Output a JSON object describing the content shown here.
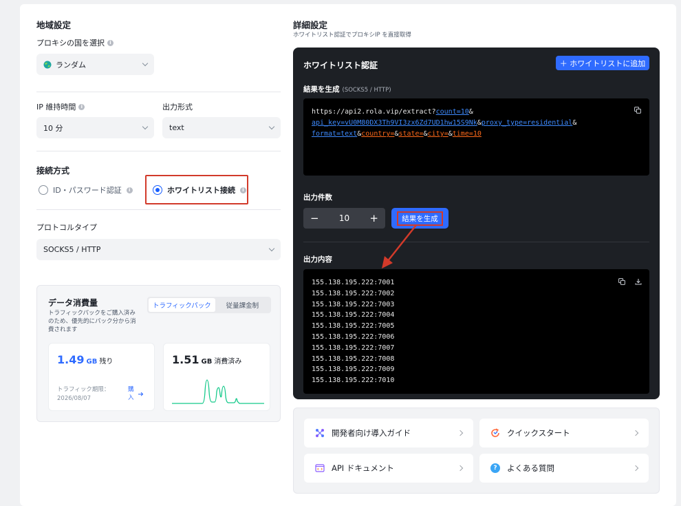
{
  "region": {
    "title": "地域設定",
    "country_label": "プロキシの国を選択",
    "country_value": "ランダム",
    "ip_duration_label": "IP 維持時間",
    "ip_duration_value": "10 分",
    "output_format_label": "出力形式",
    "output_format_value": "text"
  },
  "connection": {
    "title": "接続方式",
    "option_password": "ID・パスワード認証",
    "option_whitelist": "ホワイトリスト接続",
    "selected": "whitelist"
  },
  "protocol": {
    "label": "プロトコルタイプ",
    "value": "SOCKS5 / HTTP"
  },
  "data_usage": {
    "title": "データ消費量",
    "description": "トラフィックパックをご購入済みのため、優先的にパック分から消費されます",
    "tab_traffic": "トラフィックパック",
    "tab_metered": "従量課金制",
    "remaining_value": "1.49",
    "remaining_unit": "GB",
    "remaining_suffix": "残り",
    "expiry_label": "トラフィック期限：",
    "expiry_date": "2026/08/07",
    "buy_label": "購入",
    "consumed_value": "1.51",
    "consumed_unit": "GB",
    "consumed_suffix": "消費済み"
  },
  "advanced": {
    "title": "詳細設定",
    "subtitle": "ホワイトリスト認証でプロキシIP を直接取得"
  },
  "whitelist": {
    "title": "ホワイトリスト認証",
    "add_button": "＋ ホワイトリストに追加",
    "result_label": "結果を生成",
    "result_protocol": "(SOCKS5 / HTTP)",
    "url_base": "https://api2.rola.vip/extract?",
    "url_count": "count=10",
    "url_apikey": "api_key=vU0M80DX3Th9VI3zx6Zd7UD1hw15S9Nk",
    "url_proxy_type": "proxy_type=residential",
    "url_format": "format=text",
    "url_country": "country=",
    "url_state": "state=",
    "url_city": "city=",
    "url_time": "time=10",
    "amp": "&",
    "count_label": "出力件数",
    "count_value": "10",
    "generate_button": "結果を生成",
    "output_label": "出力内容",
    "output_lines": [
      "155.138.195.222:7001",
      "155.138.195.222:7002",
      "155.138.195.222:7003",
      "155.138.195.222:7004",
      "155.138.195.222:7005",
      "155.138.195.222:7006",
      "155.138.195.222:7007",
      "155.138.195.222:7008",
      "155.138.195.222:7009",
      "155.138.195.222:7010"
    ]
  },
  "guides": {
    "developer": "開発者向け導入ガイド",
    "quickstart": "クイックスタート",
    "api_docs": "API ドキュメント",
    "faq": "よくある質問"
  },
  "colors": {
    "accent": "#2f6bff",
    "annotation": "#d23a2a",
    "chart_line": "#14c98a"
  }
}
